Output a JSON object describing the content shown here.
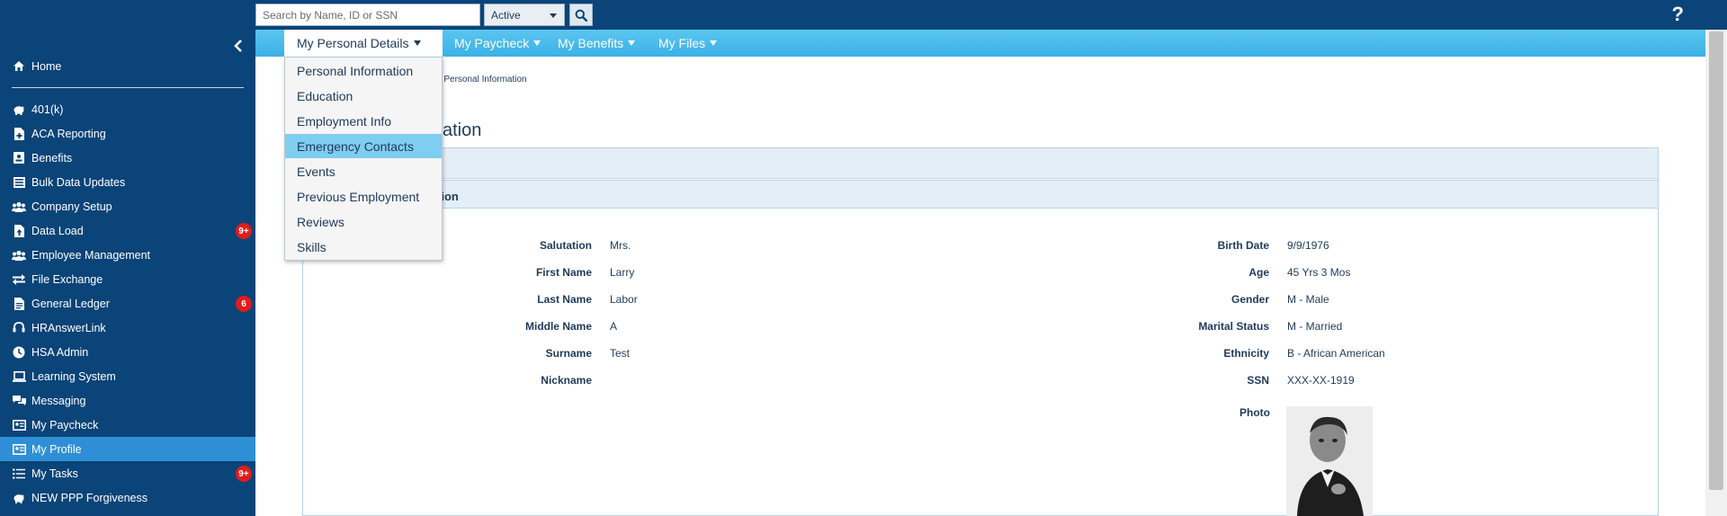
{
  "search": {
    "placeholder": "Search by Name, ID or SSN",
    "status_value": "Active"
  },
  "help_label": "?",
  "sidebar": {
    "home": "Home",
    "items": [
      {
        "label": "401(k)",
        "icon": "piggy-bank-icon"
      },
      {
        "label": "ACA Reporting",
        "icon": "file-plus-icon"
      },
      {
        "label": "Benefits",
        "icon": "id-card-icon"
      },
      {
        "label": "Bulk Data Updates",
        "icon": "list-icon"
      },
      {
        "label": "Company Setup",
        "icon": "users-icon"
      },
      {
        "label": "Data Load",
        "icon": "file-upload-icon",
        "badge": "9+"
      },
      {
        "label": "Employee Management",
        "icon": "users-icon"
      },
      {
        "label": "File Exchange",
        "icon": "exchange-icon"
      },
      {
        "label": "General Ledger",
        "icon": "document-icon",
        "badge": "6"
      },
      {
        "label": "HRAnswerLink",
        "icon": "headset-icon"
      },
      {
        "label": "HSA Admin",
        "icon": "clock-icon"
      },
      {
        "label": "Learning System",
        "icon": "laptop-icon"
      },
      {
        "label": "Messaging",
        "icon": "chat-icon"
      },
      {
        "label": "My Paycheck",
        "icon": "id-badge-icon"
      },
      {
        "label": "My Profile",
        "icon": "profile-card-icon",
        "active": true
      },
      {
        "label": "My Tasks",
        "icon": "tasks-icon",
        "badge": "9+"
      },
      {
        "label": "NEW PPP Forgiveness",
        "icon": "piggy-bank-icon"
      }
    ]
  },
  "nav": {
    "tabs": [
      {
        "label": "My Personal Details"
      },
      {
        "label": "My Paycheck"
      },
      {
        "label": "My Benefits"
      },
      {
        "label": "My Files"
      }
    ]
  },
  "dropdown": {
    "items": [
      "Personal Information",
      "Education",
      "Employment Info",
      "Emergency Contacts",
      "Events",
      "Previous Employment",
      "Reviews",
      "Skills"
    ]
  },
  "breadcrumb": "Personal Information",
  "page_title_fragment": "ation",
  "subpanel_title_fragment": "tion",
  "fields_left": [
    {
      "label": "Salutation",
      "value": "Mrs."
    },
    {
      "label": "First Name",
      "value": "Larry"
    },
    {
      "label": "Last Name",
      "value": "Labor"
    },
    {
      "label": "Middle Name",
      "value": "A"
    },
    {
      "label": "Surname",
      "value": "Test"
    },
    {
      "label": "Nickname",
      "value": ""
    }
  ],
  "fields_right": [
    {
      "label": "Birth Date",
      "value": "9/9/1976"
    },
    {
      "label": "Age",
      "value": "45 Yrs 3 Mos"
    },
    {
      "label": "Gender",
      "value": "M - Male"
    },
    {
      "label": "Marital Status",
      "value": "M - Married"
    },
    {
      "label": "Ethnicity",
      "value": "B - African American"
    },
    {
      "label": "SSN",
      "value": "XXX-XX-1919"
    }
  ],
  "photo_label": "Photo",
  "colors": {
    "header_bg": "#0b4478",
    "nav_bg": "#3bb0e6",
    "active_item": "#2f8fd6",
    "badge": "#e01c1c"
  }
}
